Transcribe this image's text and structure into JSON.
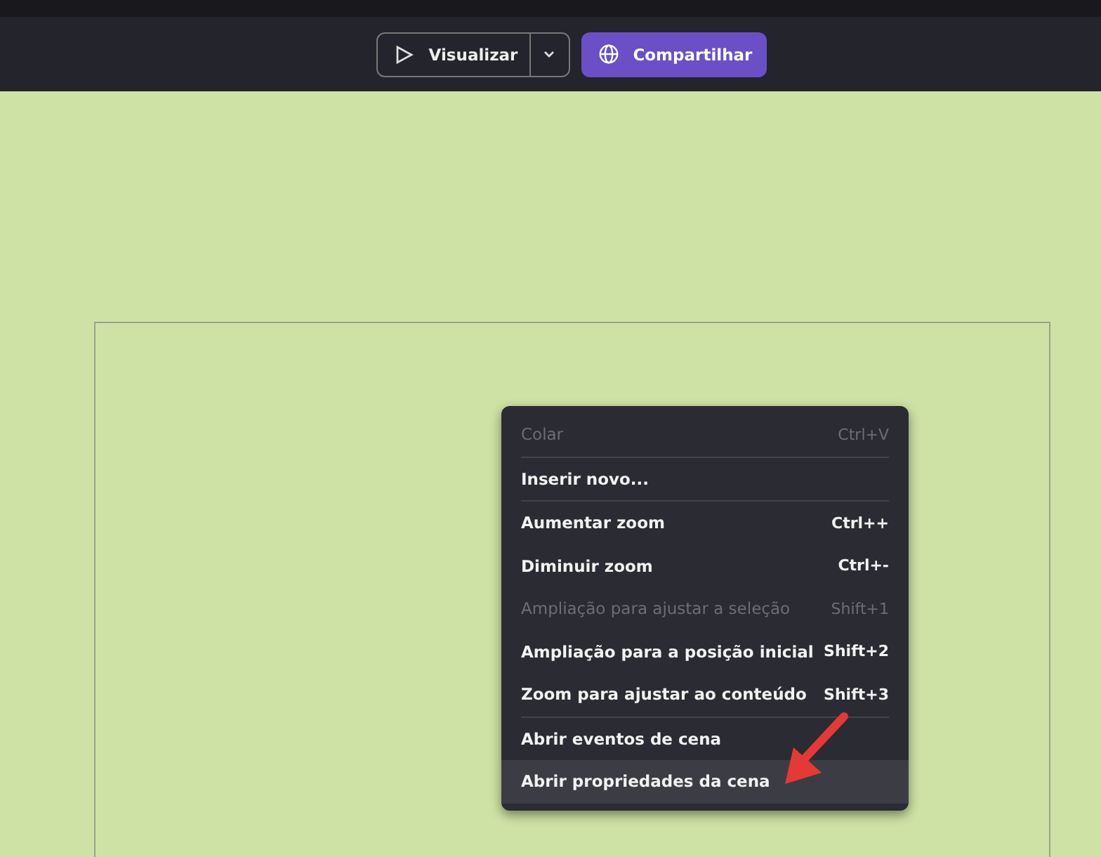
{
  "toolbar": {
    "preview_button": {
      "label": "Visualizar"
    },
    "share_button": {
      "label": "Compartilhar"
    }
  },
  "context_menu": {
    "sections": [
      {
        "items": [
          {
            "label": "Colar",
            "shortcut": "Ctrl+V",
            "disabled": true,
            "selected": false
          }
        ]
      },
      {
        "items": [
          {
            "label": "Inserir novo...",
            "disabled": false,
            "selected": false
          }
        ]
      },
      {
        "items": [
          {
            "label": "Aumentar zoom",
            "shortcut": "Ctrl++",
            "disabled": false,
            "selected": false
          },
          {
            "label": "Diminuir zoom",
            "shortcut": "Ctrl+-",
            "disabled": false,
            "selected": false
          },
          {
            "label": "Ampliação para ajustar a seleção",
            "shortcut": "Shift+1",
            "disabled": true,
            "selected": false
          },
          {
            "label": "Ampliação para a posição inicial",
            "shortcut": "Shift+2",
            "disabled": false,
            "selected": false
          },
          {
            "label": "Zoom para ajustar ao conteúdo",
            "shortcut": "Shift+3",
            "disabled": false,
            "selected": false
          }
        ]
      },
      {
        "items": [
          {
            "label": "Abrir eventos de cena",
            "disabled": false,
            "selected": false
          },
          {
            "label": "Abrir propriedades da cena",
            "disabled": false,
            "selected": true
          }
        ]
      }
    ]
  }
}
